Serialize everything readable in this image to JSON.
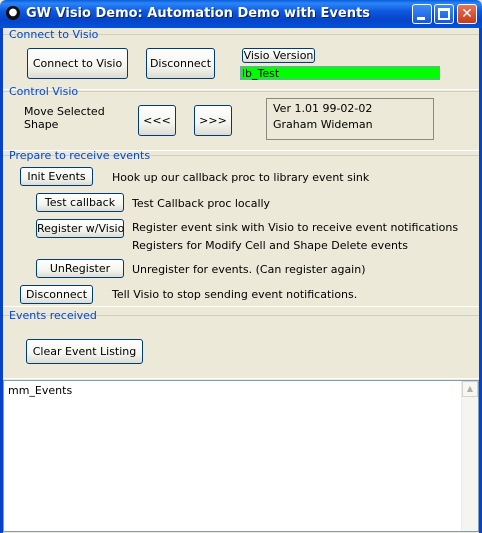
{
  "window": {
    "title": "GW Visio Demo: Automation Demo with Events",
    "icon": "paw-icon",
    "controls": {
      "minimize": "minimize-icon",
      "maximize": "maximize-icon",
      "close": "close-icon",
      "close_glyph": "✕"
    }
  },
  "connect": {
    "group_label": "Connect to Visio",
    "connect_button": "Connect to Visio",
    "disconnect_button": "Disconnect",
    "version_button": "Visio Version",
    "status_value": "lb_Test",
    "status_color": "#00ff00"
  },
  "control": {
    "group_label": "Control Visio",
    "move_label_line1": "Move Selected",
    "move_label_line2": "Shape",
    "left_button": "<<<",
    "right_button": ">>>",
    "version_line1": "Ver 1.01 99-02-02",
    "version_line2": "Graham Wideman"
  },
  "events_prep": {
    "group_label": "Prepare to receive events",
    "init_button": "Init Events",
    "init_desc": "Hook up our callback proc to library event sink",
    "test_button": "Test callback",
    "test_desc": "Test Callback proc locally",
    "register_button": "Register w/Visio",
    "register_desc1": "Register event sink with Visio to receive event notifications",
    "register_desc2": "Registers for Modify Cell and Shape Delete events",
    "unregister_button": "UnRegister",
    "unregister_desc": "Unregister for events. (Can register again)",
    "disconnect_button": "Disconnect",
    "disconnect_desc": "Tell Visio to stop sending event notifications."
  },
  "events_received": {
    "group_label": "Events received",
    "clear_button": "Clear Event Listing",
    "list_item": "mm_Events"
  }
}
